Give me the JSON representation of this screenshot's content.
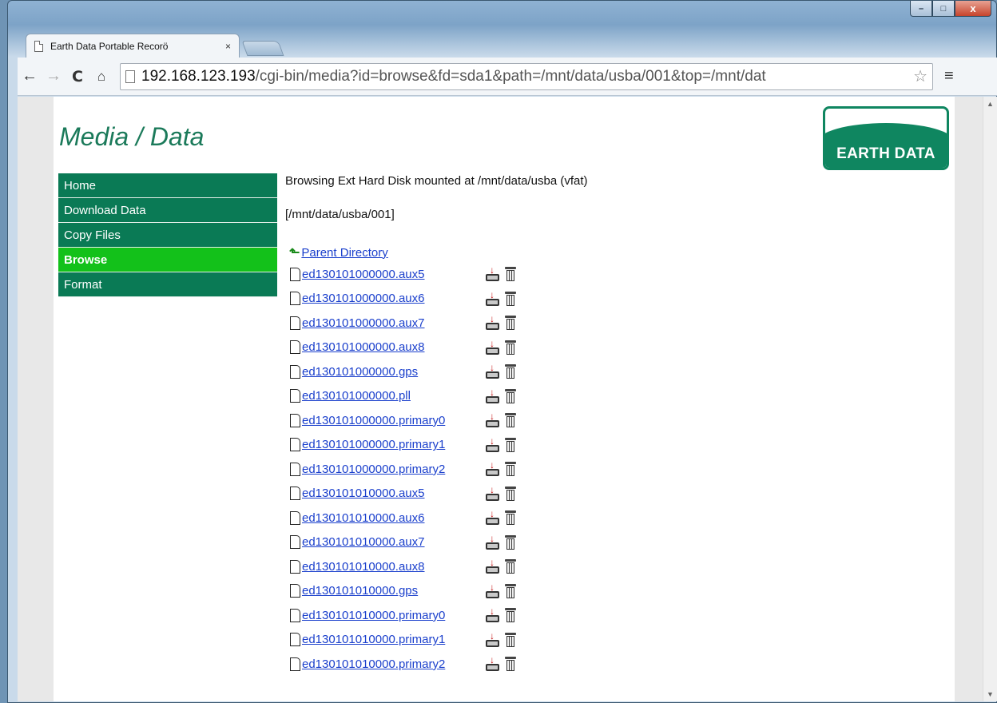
{
  "browser": {
    "tab_title": "Earth Data Portable Recorö",
    "tab_close": "×",
    "url_host": "192.168.123.193",
    "url_path": "/cgi-bin/media?id=browse&fd=sda1&path=/mnt/data/usba/001&top=/mnt/dat",
    "caption": {
      "minimize": "–",
      "maximize": "□",
      "close": "x"
    },
    "icons": {
      "back": "arrow-left-icon",
      "forward": "arrow-right-icon",
      "reload": "reload-icon",
      "home": "home-icon",
      "bookmark": "star-icon",
      "menu": "hamburger-menu-icon"
    }
  },
  "page": {
    "title": "Media / Data",
    "logo_text": "EARTH DATA",
    "menu": [
      {
        "label": "Home",
        "active": false
      },
      {
        "label": "Download Data",
        "active": false
      },
      {
        "label": "Copy Files",
        "active": false
      },
      {
        "label": "Browse",
        "active": true
      },
      {
        "label": "Format",
        "active": false
      }
    ],
    "status": "Browsing Ext Hard Disk mounted at /mnt/data/usba (vfat)",
    "cwd": "[/mnt/data/usba/001]",
    "parent_label": "Parent Directory",
    "files": [
      "ed130101000000.aux5",
      "ed130101000000.aux6",
      "ed130101000000.aux7",
      "ed130101000000.aux8",
      "ed130101000000.gps",
      "ed130101000000.pll",
      "ed130101000000.primary0",
      "ed130101000000.primary1",
      "ed130101000000.primary2",
      "ed130101010000.aux5",
      "ed130101010000.aux6",
      "ed130101010000.aux7",
      "ed130101010000.aux8",
      "ed130101010000.gps",
      "ed130101010000.primary0",
      "ed130101010000.primary1",
      "ed130101010000.primary2"
    ]
  },
  "colors": {
    "menu_bg": "#0a7a55",
    "menu_active": "#13c11a",
    "title": "#1b7a5a",
    "link": "#1a3fcc"
  }
}
